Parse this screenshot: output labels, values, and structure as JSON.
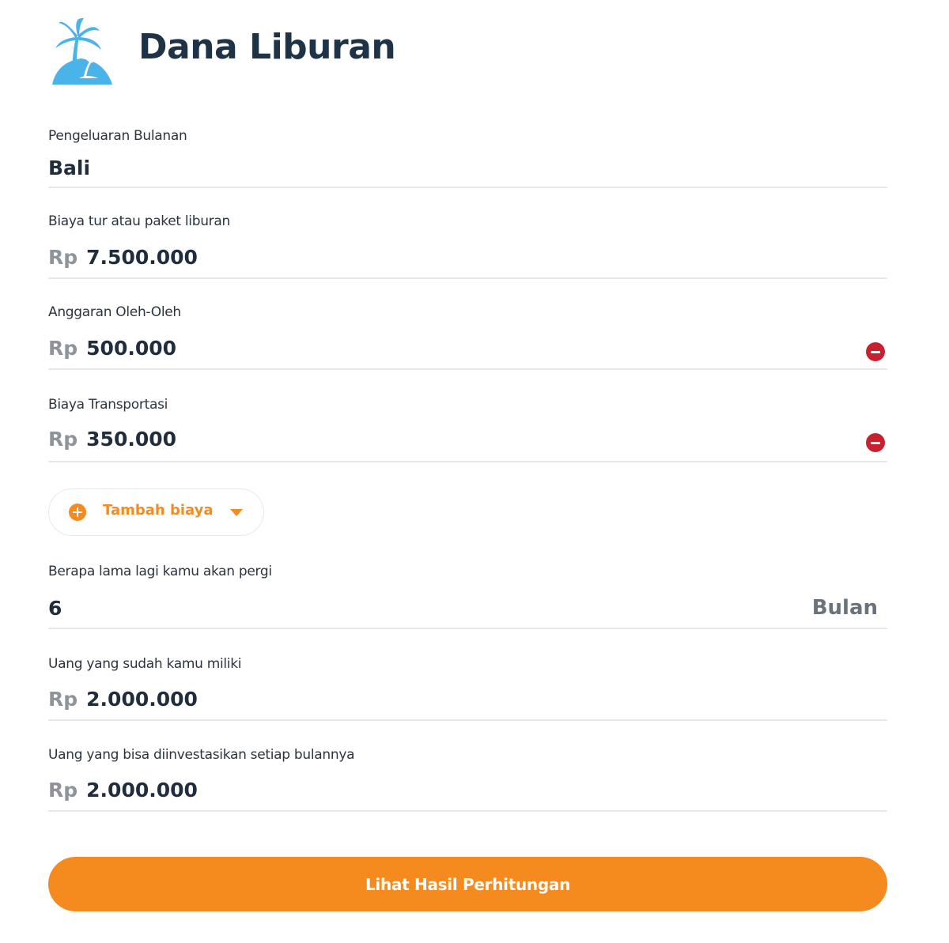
{
  "header": {
    "title": "Dana Liburan",
    "logo_icon": "palm-island-icon",
    "logo_color": "#4ab4ea"
  },
  "fields": {
    "destination": {
      "label": "Pengeluaran Bulanan",
      "value": "Bali"
    },
    "tour_cost": {
      "label": "Biaya tur atau paket liburan",
      "currency": "Rp",
      "value": "7.500.000"
    },
    "souvenir_budget": {
      "label": "Anggaran Oleh-Oleh",
      "currency": "Rp",
      "value": "500.000",
      "remove_icon": "minus-circle-icon"
    },
    "transport_cost": {
      "label": "Biaya Transportasi",
      "currency": "Rp",
      "value": "350.000",
      "remove_icon": "minus-circle-icon"
    },
    "duration": {
      "label": "Berapa lama lagi kamu akan pergi",
      "value": "6",
      "unit": "Bulan"
    },
    "current_savings": {
      "label": "Uang yang sudah kamu miliki",
      "currency": "Rp",
      "value": "2.000.000"
    },
    "monthly_investment": {
      "label": "Uang yang bisa diinvestasikan setiap bulannya",
      "currency": "Rp",
      "value": "2.000.000"
    }
  },
  "add_cost": {
    "label": "Tambah biaya",
    "icon": "plus-circle-icon",
    "caret_icon": "caret-down-icon"
  },
  "submit": {
    "label": "Lihat Hasil Perhitungan"
  },
  "colors": {
    "accent": "#f58a1f",
    "remove": "#c8202f",
    "divider": "#e6e8eb",
    "title": "#1f3347"
  }
}
